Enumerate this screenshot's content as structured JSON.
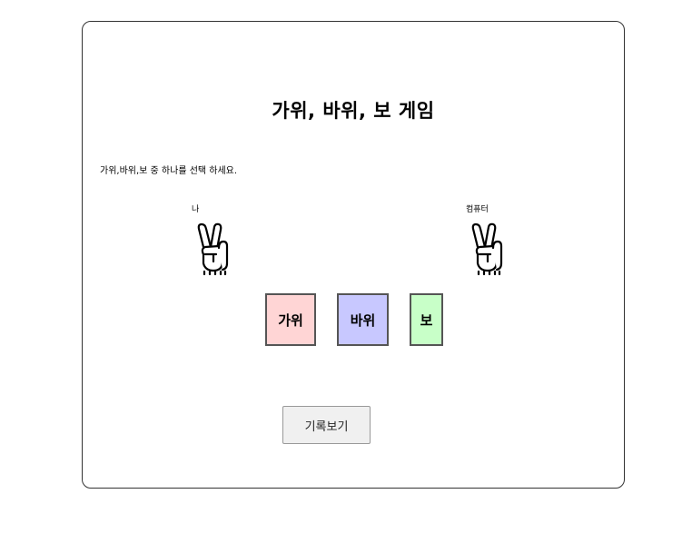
{
  "game": {
    "title": "가위, 바위, 보 게임",
    "instruction": "가위,바위,보 중 하나를 선택 하세요.",
    "player_label": "나",
    "computer_label": "컴퓨터",
    "player_hand_icon": "victory-hand-icon",
    "computer_hand_icon": "victory-hand-icon"
  },
  "choices": {
    "scissors_label": "가위",
    "rock_label": "바위",
    "paper_label": "보",
    "scissors_color": "#ffd5d5",
    "rock_color": "#c8c8ff",
    "paper_color": "#c8ffc8"
  },
  "history": {
    "button_label": "기록보기"
  }
}
